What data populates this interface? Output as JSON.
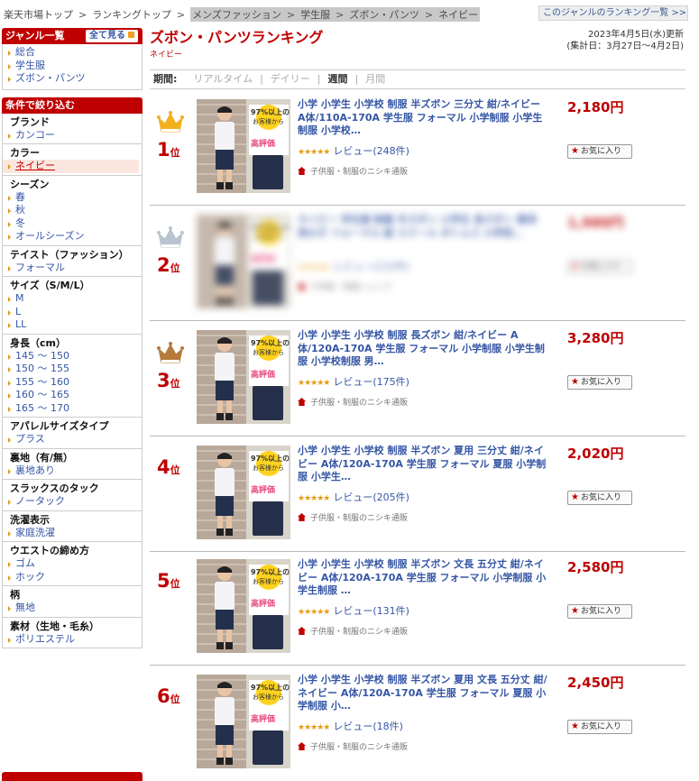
{
  "breadcrumb": {
    "items": [
      "楽天市場トップ",
      "ランキングトップ"
    ],
    "active_items": [
      "メンズファッション",
      "学生服",
      "ズボン・パンツ",
      "ネイビー"
    ],
    "genre_ranking_link": "このジャンルのランキング一覧 >>"
  },
  "genre_box": {
    "title": "ジャンル一覧",
    "show_all": "全て見る",
    "items": [
      "総合",
      "学生服",
      "ズボン・パンツ"
    ]
  },
  "filter_box": {
    "title": "条件で絞り込む",
    "groups": [
      {
        "title": "ブランド",
        "items": [
          "カンコー"
        ]
      },
      {
        "title": "カラー",
        "items": [
          "ネイビー"
        ],
        "selected": "ネイビー"
      },
      {
        "title": "シーズン",
        "items": [
          "春",
          "秋",
          "冬",
          "オールシーズン"
        ]
      },
      {
        "title": "テイスト（ファッション）",
        "items": [
          "フォーマル"
        ]
      },
      {
        "title": "サイズ（S/M/L）",
        "items": [
          "M",
          "L",
          "LL"
        ]
      },
      {
        "title": "身長（cm）",
        "items": [
          "145 ～ 150",
          "150 ～ 155",
          "155 ～ 160",
          "160 ～ 165",
          "165 ～ 170"
        ]
      },
      {
        "title": "アパレルサイズタイプ",
        "items": [
          "プラス"
        ]
      },
      {
        "title": "裏地（有/無）",
        "items": [
          "裏地あり"
        ]
      },
      {
        "title": "スラックスのタック",
        "items": [
          "ノータック"
        ]
      },
      {
        "title": "洗濯表示",
        "items": [
          "家庭洗濯"
        ]
      },
      {
        "title": "ウエストの締め方",
        "items": [
          "ゴム",
          "ホック"
        ]
      },
      {
        "title": "柄",
        "items": [
          "無地"
        ]
      },
      {
        "title": "素材（生地・毛糸）",
        "items": [
          "ポリエステル"
        ]
      }
    ]
  },
  "main": {
    "title": "ズボン・パンツランキング",
    "subtitle": "ネイビー",
    "updated": "2023年4月5日(水)更新",
    "period_range": "(集計日：3月27日～4月2日)",
    "period_label": "期間:",
    "tabs": [
      "リアルタイム",
      "デイリー",
      "週間",
      "月間"
    ],
    "active_tab": "週間"
  },
  "badge": {
    "line1": "97%以上の",
    "line2": "お客様から",
    "line3": "高評価"
  },
  "rank_unit": "位",
  "fav_label": "お気に入り",
  "items": [
    {
      "rank": "1",
      "title": "小学 小学生 小学校 制服 半ズボン 三分丈 紺/ネイビー A体/110A-170A 学生服 フォーマル 小学制服 小学生制服 小学校…",
      "review": "レビュー(248件)",
      "shop": "子供服・制服のニシキ通販",
      "price": "2,180円",
      "crown": "gold",
      "blurred": false
    },
    {
      "rank": "2",
      "title": "ネイビー 学生服 制服 半ズボン 小学生 長ズボン 夏用 男の子 フォーマル 紺 スクール ボトムス 小学校…",
      "review": "レビュー(112件)",
      "shop": "子供服・制服ショップ",
      "price": "1,980円",
      "crown": "silver",
      "blurred": true
    },
    {
      "rank": "3",
      "title": "小学 小学生 小学校 制服 長ズボン 紺/ネイビー A体/120A-170A 学生服 フォーマル 小学制服 小学生制服 小学校制服 男…",
      "review": "レビュー(175件)",
      "shop": "子供服・制服のニシキ通販",
      "price": "3,280円",
      "crown": "bronze",
      "blurred": false
    },
    {
      "rank": "4",
      "title": "小学 小学生 小学校 制服 半ズボン 夏用 三分丈 紺/ネイビー A体/120A-170A 学生服 フォーマル 夏服 小学制服 小学生…",
      "review": "レビュー(205件)",
      "shop": "子供服・制服のニシキ通販",
      "price": "2,020円",
      "crown": "none",
      "blurred": false
    },
    {
      "rank": "5",
      "title": "小学 小学生 小学校 制服 半ズボン 文長 五分丈 紺/ネイビー A体/120A-170A 学生服 フォーマル 小学制服 小学生制服 …",
      "review": "レビュー(131件)",
      "shop": "子供服・制服のニシキ通販",
      "price": "2,580円",
      "crown": "none",
      "blurred": false
    },
    {
      "rank": "6",
      "title": "小学 小学生 小学校 制服 半ズボン 夏用 文長 五分丈 紺/ネイビー A体/120A-170A 学生服 フォーマル 夏服 小学制服 小…",
      "review": "レビュー(18件)",
      "shop": "子供服・制服のニシキ通販",
      "price": "2,450円",
      "crown": "none",
      "blurred": false
    }
  ],
  "colors": {
    "accent": "#bf0000",
    "link": "#3556a5",
    "star": "#e89b12",
    "gold": "#f2b01e",
    "silver": "#b8c4cf",
    "bronze": "#b57b3b"
  }
}
